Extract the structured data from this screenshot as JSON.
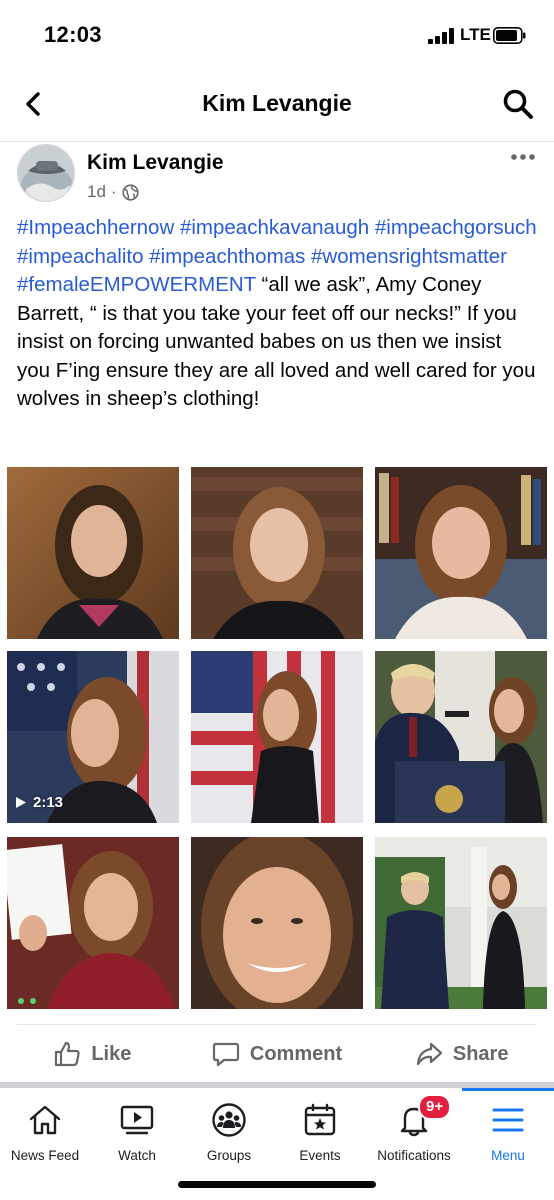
{
  "status": {
    "time": "12:03",
    "network": "LTE"
  },
  "nav": {
    "title": "Kim Levangie",
    "back_icon": "chevron-left-icon",
    "search_icon": "search-icon"
  },
  "post": {
    "author": "Kim Levangie",
    "time": "1d",
    "separator": "·",
    "privacy_icon": "globe-icon",
    "text_segments": [
      {
        "text": "#Impeachhernow",
        "type": "hashtag"
      },
      {
        "text": " ",
        "type": "plain"
      },
      {
        "text": "#impeachkavanaugh",
        "type": "hashtag"
      },
      {
        "text": " ",
        "type": "plain"
      },
      {
        "text": "#impeachgorsuch",
        "type": "hashtag"
      },
      {
        "text": " ",
        "type": "plain"
      },
      {
        "text": "#impeachalito",
        "type": "hashtag"
      },
      {
        "text": " ",
        "type": "plain"
      },
      {
        "text": "#impeachthomas",
        "type": "hashtag"
      },
      {
        "text": " ",
        "type": "plain"
      },
      {
        "text": "#womensrightsmatter",
        "type": "hashtag"
      },
      {
        "text": " ",
        "type": "plain"
      },
      {
        "text": "#femaleEMPOWERMENT",
        "type": "hashtag"
      },
      {
        "text": " “all we ask”, Amy Coney Barrett, “ is that you take your feet off our necks!”  If you insist on forcing unwanted babes on us then we insist you F’ing ensure they are all loved and well cared for you wolves in sheep’s clothing!",
        "type": "plain"
      }
    ],
    "video_duration": "2:13"
  },
  "actions": {
    "like": "Like",
    "comment": "Comment",
    "share": "Share"
  },
  "tabs": [
    {
      "label": "News Feed",
      "icon": "home-icon"
    },
    {
      "label": "Watch",
      "icon": "watch-icon"
    },
    {
      "label": "Groups",
      "icon": "groups-icon"
    },
    {
      "label": "Events",
      "icon": "events-icon"
    },
    {
      "label": "Notifications",
      "icon": "bell-icon",
      "badge": "9+"
    },
    {
      "label": "Menu",
      "icon": "menu-icon",
      "active": true
    }
  ],
  "colors": {
    "accent": "#1877f2",
    "hashtag": "#2a5bd7",
    "badge": "#e41e3f",
    "secondary_text": "#65676b"
  }
}
